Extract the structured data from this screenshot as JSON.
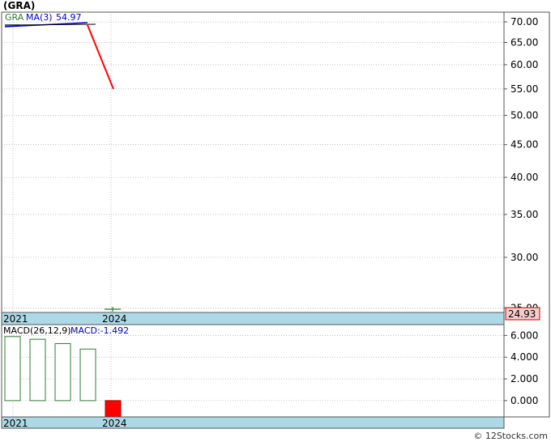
{
  "title": "(GRA)",
  "watermark": "© 12Stocks.com",
  "colors": {
    "price_up": "#2e7d32",
    "price_down": "#ff0000",
    "ma": "#0000cc",
    "macd_text": "#0000aa",
    "band": "#add8e6",
    "last_price_box": "#f4cccc",
    "grid": "#999999"
  },
  "chart_data": [
    {
      "type": "line",
      "panel": "price",
      "x": [
        "2021",
        "2024"
      ],
      "series": [
        {
          "name": "GRA",
          "values": [
            69.2,
            54.97
          ]
        },
        {
          "name": "MA(3)",
          "values": [
            69.2,
            69.8
          ]
        }
      ],
      "legend": {
        "ticker": "GRA",
        "ma_label": "MA(3)",
        "ma_value": "54.97"
      },
      "y_scale": "log",
      "ylim": [
        24.6,
        72.5
      ],
      "y_ticks": [
        "70.00",
        "65.00",
        "60.00",
        "55.00",
        "50.00",
        "45.00",
        "40.00",
        "35.00",
        "30.00",
        "25.00"
      ],
      "x_tick_labels": [
        "2021",
        "2024"
      ],
      "last_price": "24.93",
      "grid": true
    },
    {
      "type": "bar",
      "panel": "macd",
      "categories": [
        "2021",
        "",
        "",
        "",
        "2024"
      ],
      "values": [
        5.9,
        5.65,
        5.25,
        4.75,
        -1.49
      ],
      "legend": {
        "label": "MACD(26,12,9)",
        "value_label": "MACD:-1.492"
      },
      "ylim": [
        -1.5,
        7.0
      ],
      "y_ticks": [
        "6.000",
        "4.000",
        "2.000",
        "0.000"
      ],
      "x_tick_labels": [
        "2021",
        "2024"
      ],
      "grid": true
    }
  ]
}
